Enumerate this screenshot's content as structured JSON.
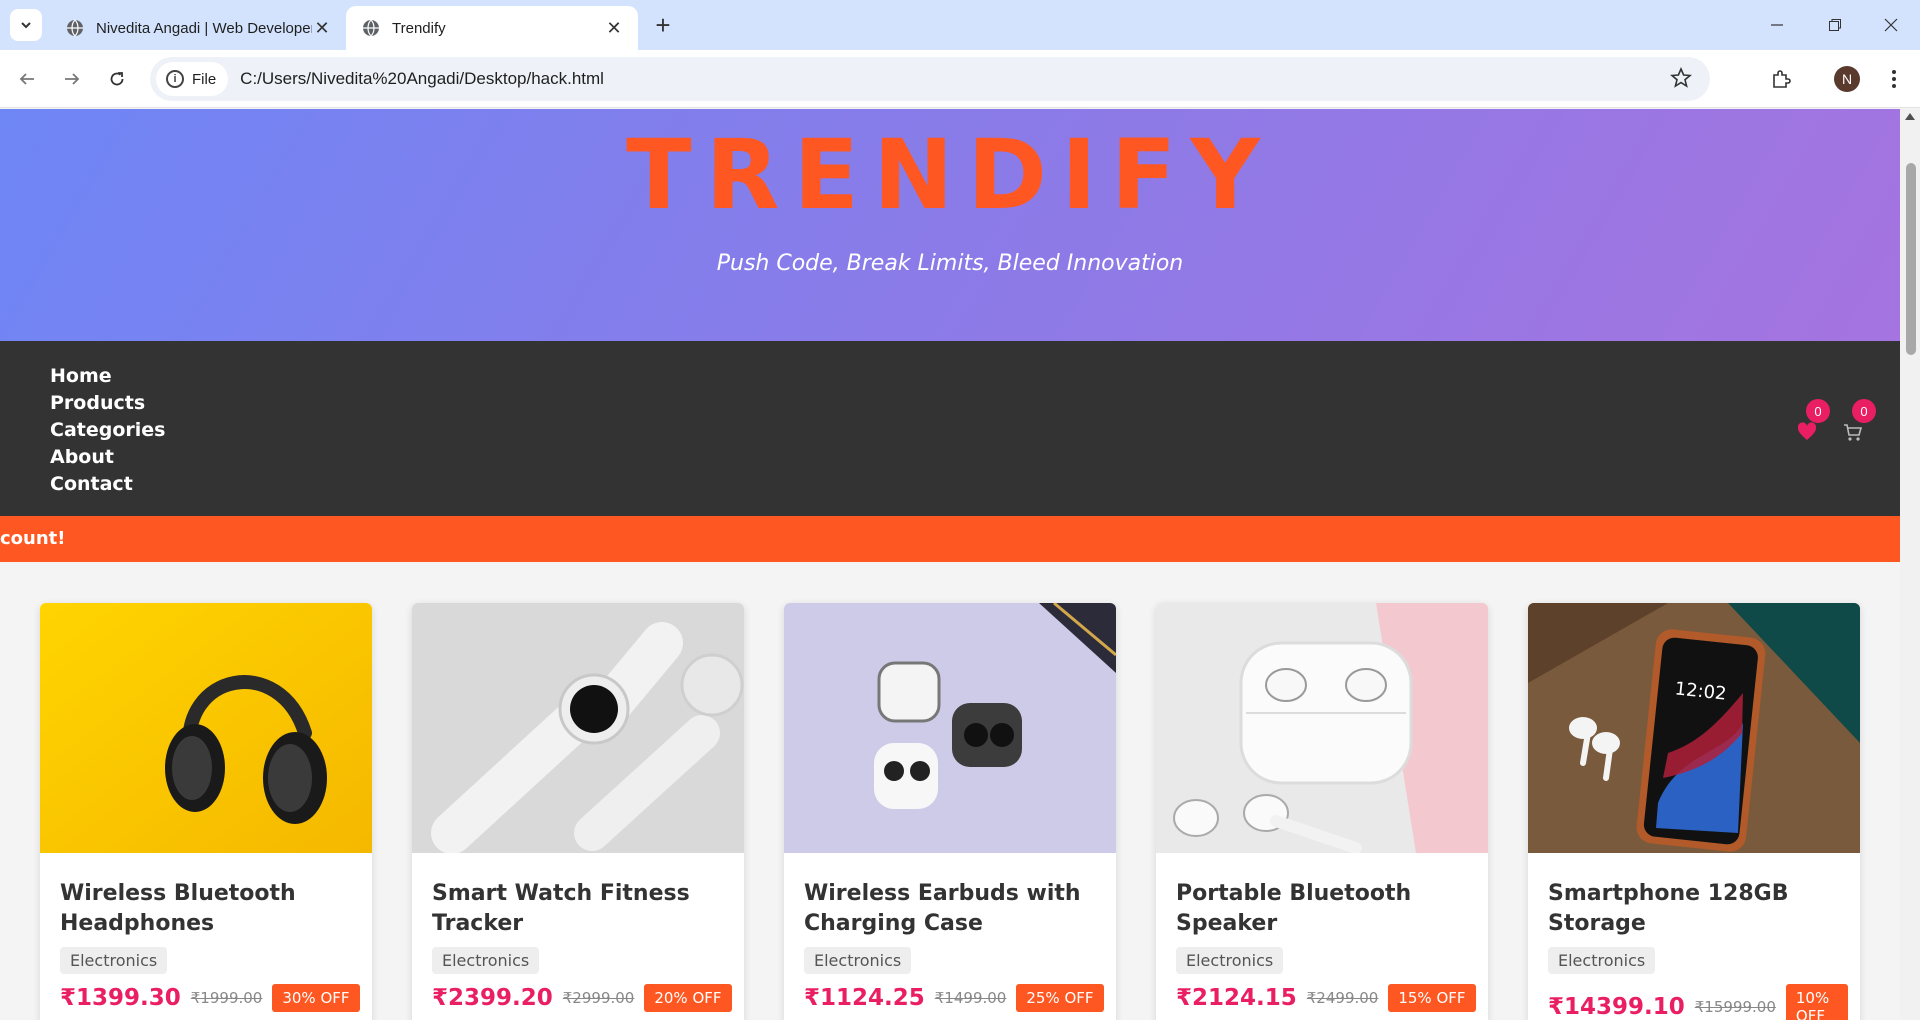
{
  "browser": {
    "tabs": [
      {
        "title": "Nivedita Angadi | Web Developer",
        "active": false
      },
      {
        "title": "Trendify",
        "active": true
      }
    ],
    "address": {
      "scheme_label": "File",
      "url": "C:/Users/Nivedita%20Angadi/Desktop/hack.html"
    },
    "profile_initial": "N"
  },
  "site": {
    "logo": "TRENDIFY",
    "tagline": "Push Code, Break Limits, Bleed Innovation",
    "nav": [
      "Home",
      "Products",
      "Categories",
      "About",
      "Contact"
    ],
    "wishlist_count": "0",
    "cart_count": "0",
    "banner": "count!"
  },
  "products": [
    {
      "title": "Wireless Bluetooth Headphones",
      "category": "Electronics",
      "price": "₹1399.30",
      "old_price": "₹1999.00",
      "discount": "30% OFF",
      "image": "headphones"
    },
    {
      "title": "Smart Watch Fitness Tracker",
      "category": "Electronics",
      "price": "₹2399.20",
      "old_price": "₹2999.00",
      "discount": "20% OFF",
      "image": "smartwatch"
    },
    {
      "title": "Wireless Earbuds with Charging Case",
      "category": "Electronics",
      "price": "₹1124.25",
      "old_price": "₹1499.00",
      "discount": "25% OFF",
      "image": "earbuds"
    },
    {
      "title": "Portable Bluetooth Speaker",
      "category": "Electronics",
      "price": "₹2124.15",
      "old_price": "₹2499.00",
      "discount": "15% OFF",
      "image": "airpods-case"
    },
    {
      "title": "Smartphone 128GB Storage",
      "category": "Electronics",
      "price": "₹14399.10",
      "old_price": "₹15999.00",
      "discount": "10% OFF",
      "image": "smartphone"
    }
  ],
  "colors": {
    "accent": "#ff5722",
    "price": "#e91e63",
    "nav_bg": "#333333"
  }
}
